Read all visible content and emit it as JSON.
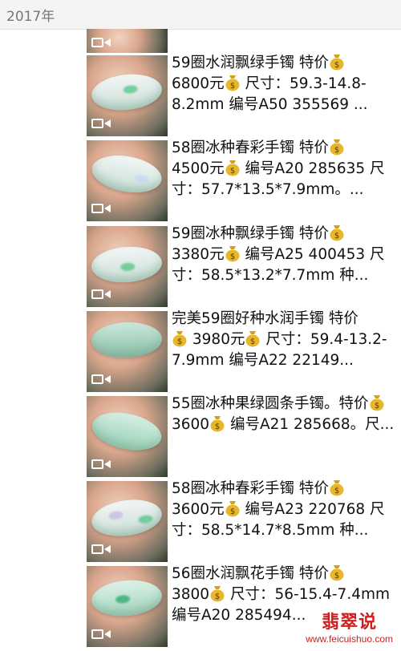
{
  "header": {
    "title": "2017年"
  },
  "posts": [
    {
      "segments": [
        "59圈水润飘绿手镯 特价",
        "6800元",
        " 尺寸：59.3-14.8-8.2mm 编号A50 355569 ..."
      ]
    },
    {
      "segments": [
        "58圈冰种春彩手镯 特价",
        "4500元",
        " 编号A20 285635 尺寸：57.7*13.5*7.9mm。..."
      ]
    },
    {
      "segments": [
        "59圈冰种飘绿手镯 特价",
        "3380元",
        " 编号A25 400453 尺寸：58.5*13.2*7.7mm 种..."
      ]
    },
    {
      "segments": [
        "完美59圈好种水润手镯 特价",
        " 3980元",
        " 尺寸：59.4-13.2-7.9mm 编号A22 22149..."
      ]
    },
    {
      "segments": [
        "55圈冰种果绿圆条手镯。特价",
        " 3600",
        "  编号A21 285668。尺..."
      ]
    },
    {
      "segments": [
        "58圈冰种春彩手镯 特价",
        "3600元",
        " 编号A23 220768 尺寸：58.5*14.7*8.5mm 种..."
      ]
    },
    {
      "segments": [
        "56圈水润飘花手镯 特价",
        "3800",
        " 尺寸：56-15.4-7.4mm 编号A20 285494..."
      ]
    }
  ],
  "watermark": {
    "title": "翡翠说",
    "url": "www.feicuishuo.com"
  },
  "icons": {
    "money": "money-bag-icon",
    "video": "video-camera-icon"
  }
}
